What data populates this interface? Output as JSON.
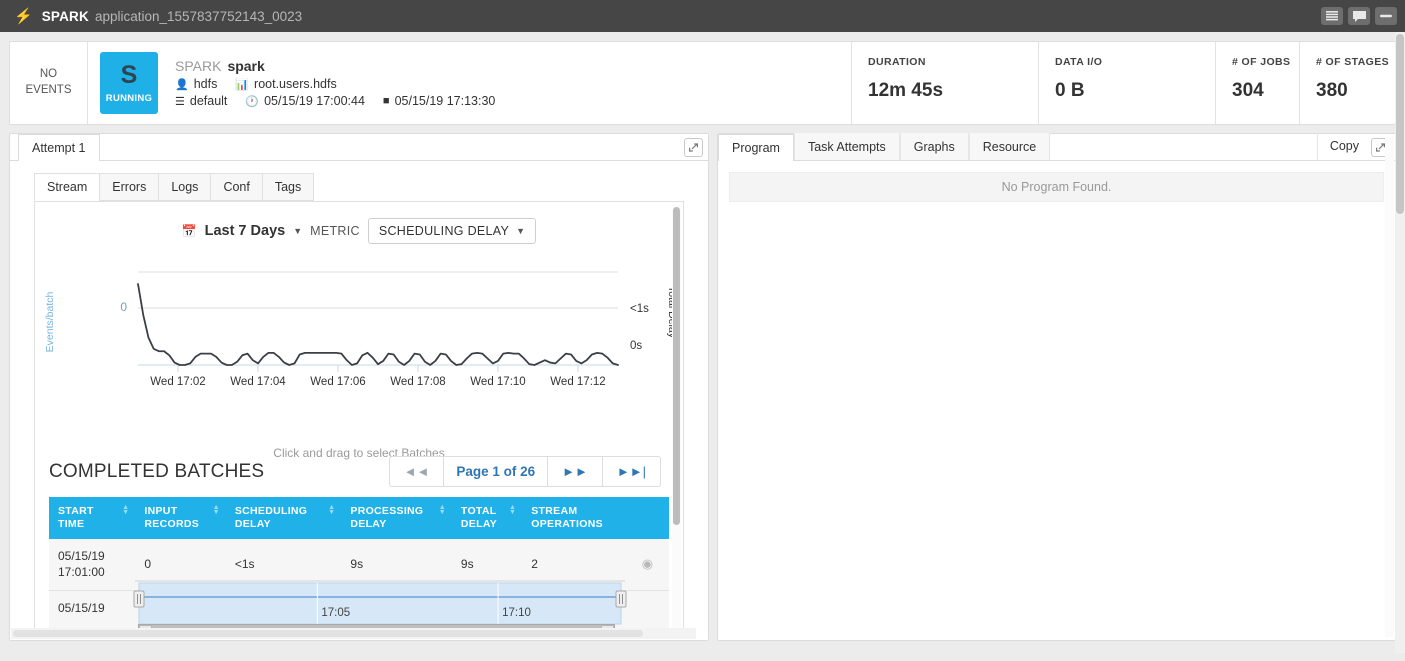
{
  "titlebar": {
    "bolt_icon": "bolt-icon",
    "app_name": "SPARK",
    "app_id": "application_1557837752143_0023",
    "window_buttons": [
      {
        "name": "lines-icon",
        "label": ""
      },
      {
        "name": "comment-icon",
        "label": ""
      },
      {
        "name": "minimize-icon",
        "label": ""
      }
    ]
  },
  "summary": {
    "no_events_line1": "NO",
    "no_events_line2": "EVENTS",
    "badge_letter": "S",
    "badge_state": "RUNNING",
    "badge_color": "#1eb0e6",
    "app_type": "SPARK",
    "app_title": "spark",
    "user": "hdfs",
    "queue": "root.users.hdfs",
    "pool": "default",
    "start_time": "05/15/19 17:00:44",
    "end_time": "05/15/19 17:13:30",
    "stats": [
      {
        "key": "DURATION",
        "value": "12m 45s"
      },
      {
        "key": "DATA I/O",
        "value": "0 B"
      },
      {
        "key": "# OF JOBS",
        "value": "304"
      },
      {
        "key": "# OF STAGES",
        "value": "380"
      }
    ]
  },
  "left_panel": {
    "attempt_tab": "Attempt 1",
    "expand_icon": "expand-icon",
    "subtabs": [
      {
        "label": "Stream",
        "active": true
      },
      {
        "label": "Errors",
        "active": false
      },
      {
        "label": "Logs",
        "active": false
      },
      {
        "label": "Conf",
        "active": false
      },
      {
        "label": "Tags",
        "active": false
      }
    ],
    "chart_controls": {
      "calendar_icon": "calendar-icon",
      "range": "Last 7 Days",
      "metric_label": "METRIC",
      "metric_value": "SCHEDULING DELAY"
    },
    "brush": {
      "tick_left": "17:05",
      "tick_right": "17:10",
      "left_arrow": "◄",
      "right_arrow": "►",
      "grip": "|||"
    },
    "hint": "Click and drag to select Batches",
    "batches_title": "COMPLETED BATCHES",
    "pager": {
      "first": "◄◄",
      "page_text": "Page 1 of 26",
      "next": "►►",
      "last": "►►|"
    },
    "table": {
      "columns": [
        {
          "l1": "START",
          "l2": "TIME",
          "sortable": true
        },
        {
          "l1": "INPUT",
          "l2": "RECORDS",
          "sortable": true
        },
        {
          "l1": "SCHEDULING",
          "l2": "DELAY",
          "sortable": true
        },
        {
          "l1": "PROCESSING",
          "l2": "DELAY",
          "sortable": true
        },
        {
          "l1": "TOTAL",
          "l2": "DELAY",
          "sortable": true
        },
        {
          "l1": "STREAM",
          "l2": "OPERATIONS",
          "sortable": false
        },
        {
          "l1": "",
          "l2": "",
          "sortable": false
        }
      ],
      "rows": [
        {
          "start_time_1": "05/15/19",
          "start_time_2": "17:01:00",
          "input_records": "0",
          "scheduling_delay": "<1s",
          "processing_delay": "9s",
          "total_delay": "9s",
          "stream_operations": "2",
          "action_icon": "eye-icon"
        },
        {
          "start_time_1": "05/15/19",
          "start_time_2": "",
          "input_records": "",
          "scheduling_delay": "",
          "processing_delay": "",
          "total_delay": "",
          "stream_operations": "",
          "action_icon": ""
        }
      ]
    }
  },
  "right_panel": {
    "tabs": [
      {
        "label": "Program",
        "active": true
      },
      {
        "label": "Task Attempts",
        "active": false
      },
      {
        "label": "Graphs",
        "active": false
      },
      {
        "label": "Resource",
        "active": false
      }
    ],
    "copy_label": "Copy",
    "expand_icon": "expand-icon",
    "empty_message": "No Program Found."
  },
  "chart_data": {
    "type": "line",
    "title": "",
    "xlabel": "",
    "ylabel": "Events/batch",
    "y2label": "Total Delay",
    "y_left_ticks": [
      "0"
    ],
    "y_right_ticks": [
      "<1s",
      "0s"
    ],
    "x_tick_labels": [
      "Wed 17:02",
      "Wed 17:04",
      "Wed 17:06",
      "Wed 17:08",
      "Wed 17:10",
      "Wed 17:12"
    ],
    "grid": true,
    "legend": "none",
    "series": [
      {
        "name": "Total Delay",
        "color": "#3a3f47",
        "values": [
          1.0,
          0.62,
          0.34,
          0.2,
          0.17,
          0.17,
          0.12,
          0.03,
          0.0,
          0.0,
          0.02,
          0.1,
          0.14,
          0.14,
          0.14,
          0.1,
          0.03,
          0.0,
          0.0,
          0.04,
          0.12,
          0.14,
          0.06,
          0.02,
          0.1,
          0.15,
          0.15,
          0.1,
          0.03,
          0.0,
          0.02,
          0.13,
          0.15,
          0.15,
          0.15,
          0.15,
          0.15,
          0.15,
          0.15,
          0.14,
          0.06,
          0.0,
          0.02,
          0.12,
          0.15,
          0.09,
          0.01,
          0.05,
          0.14,
          0.13,
          0.04,
          0.0,
          0.05,
          0.14,
          0.13,
          0.04,
          0.0,
          0.05,
          0.14,
          0.13,
          0.05,
          0.0,
          0.01,
          0.08,
          0.14,
          0.15,
          0.14,
          0.08,
          0.02,
          0.05,
          0.14,
          0.15,
          0.14,
          0.14,
          0.08,
          0.01,
          0.0,
          0.03,
          0.06,
          0.03,
          0.02,
          0.08,
          0.14,
          0.13,
          0.05,
          0.02,
          0.06,
          0.13,
          0.15,
          0.14,
          0.09,
          0.02,
          0.0
        ]
      }
    ],
    "brush": {
      "selection_start_pct": 0,
      "selection_end_pct": 100,
      "ticks": [
        "17:05",
        "17:10"
      ]
    }
  }
}
